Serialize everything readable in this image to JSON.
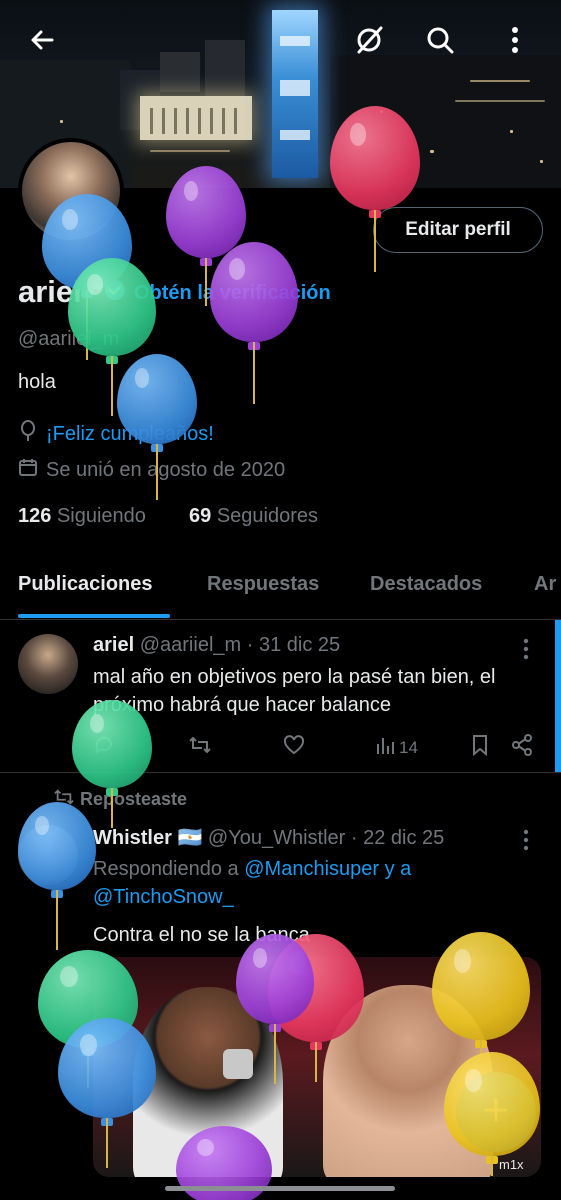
{
  "profile": {
    "name": "ariel",
    "verify_cta": "Obtén la verificación",
    "handle": "@aariiel_m",
    "bio": "hola",
    "birthday": "¡Feliz cumpleaños!",
    "joined": "Se unió en agosto de 2020",
    "following_count": "126",
    "following_label": "Siguiendo",
    "followers_count": "69",
    "followers_label": "Seguidores",
    "edit_button": "Editar perfil"
  },
  "tabs": [
    "Publicaciones",
    "Respuestas",
    "Destacados",
    "Ar"
  ],
  "posts": [
    {
      "author": "ariel",
      "handle": "@aariiel_m",
      "date": "· 31 dic 25",
      "text": "mal año en objetivos pero la pasé tan bien, el próximo habrá que hacer balance",
      "views": "14"
    },
    {
      "repost_label": "Reposteaste",
      "author": "Whistler 🇦🇷",
      "handle": "@You_Whistler",
      "date": "· 22 dic 25",
      "reply_prefix": "Respondiendo a",
      "reply_user1": "@Manchisuper",
      "reply_and": "y a",
      "reply_user2": "@TinchoSnow_",
      "text": "Contra el no se la banca",
      "media_badge": "m1x"
    }
  ],
  "icons": [
    "back-arrow-icon",
    "grok-icon",
    "search-icon",
    "more-vert-icon",
    "verified-badge-icon",
    "balloon-icon",
    "calendar-icon",
    "reply-icon",
    "repost-icon",
    "like-icon",
    "views-icon",
    "bookmark-icon",
    "share-icon",
    "compose-icon"
  ],
  "colors": {
    "accent": "#1d9bf0",
    "background": "#000000",
    "text": "#e7e9ea",
    "muted": "#71767b",
    "balloon_blue": "#3d8fe0",
    "balloon_purple": "#9b3fd8",
    "balloon_green": "#2fc98a",
    "balloon_red": "#e8375f",
    "balloon_yellow": "#e9c21c"
  }
}
